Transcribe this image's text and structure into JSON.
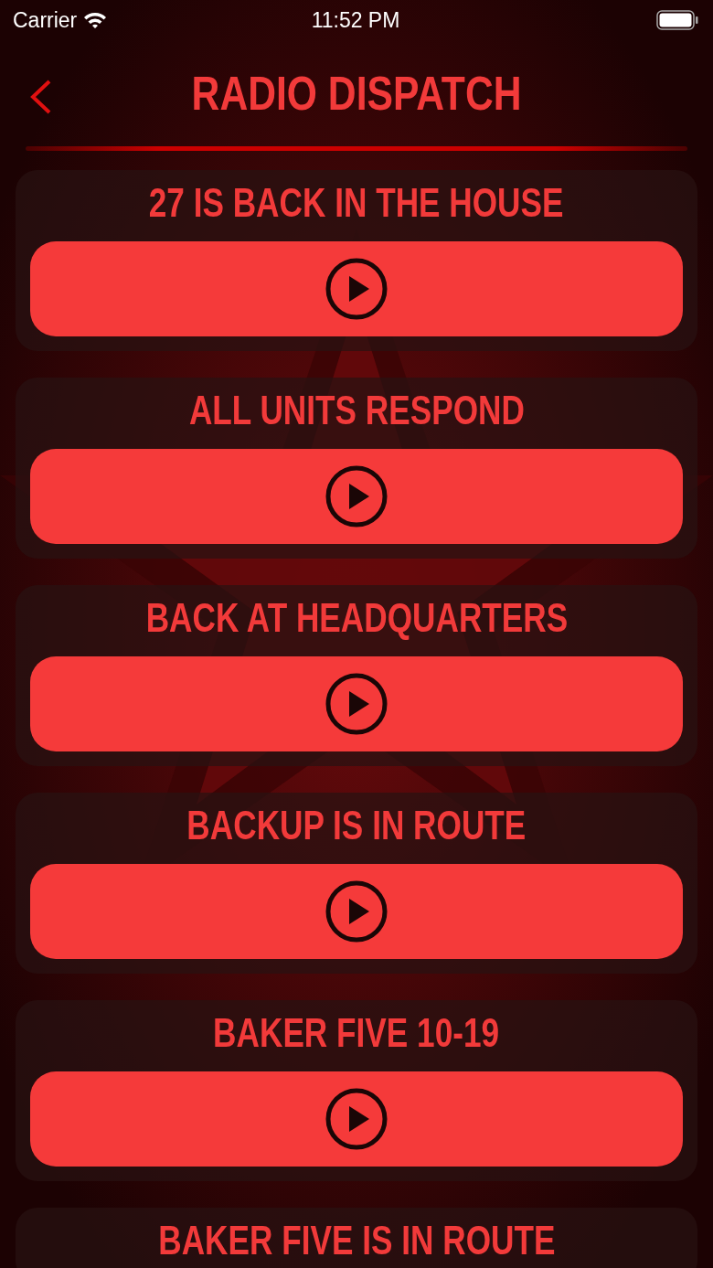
{
  "status_bar": {
    "carrier": "Carrier",
    "time": "11:52 PM"
  },
  "header": {
    "title": "RADIO DISPATCH"
  },
  "sounds": [
    {
      "title": "27 IS BACK IN THE HOUSE"
    },
    {
      "title": "ALL UNITS RESPOND"
    },
    {
      "title": "BACK AT HEADQUARTERS"
    },
    {
      "title": "BACKUP IS IN ROUTE"
    },
    {
      "title": "BAKER FIVE 10-19"
    },
    {
      "title": "BAKER FIVE IS IN ROUTE"
    }
  ]
}
